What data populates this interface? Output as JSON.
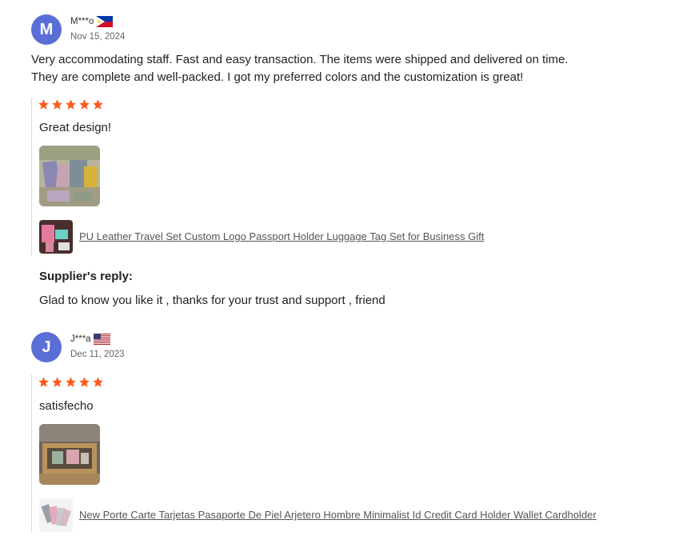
{
  "reviews": [
    {
      "avatar_letter": "M",
      "username": "M***o",
      "flag": "philippines-flag",
      "date": "Nov 15, 2024",
      "text_lines": [
        "Very accommodating staff. Fast and easy transaction. The items were shipped and delivered on time.",
        "They are complete and well-packed. I got my preferred colors and the customization is great!"
      ],
      "rating": 5,
      "comment": "Great design!",
      "product_link": "PU Leather Travel Set Custom Logo Passport Holder Luggage Tag Set for Business Gift",
      "reply": {
        "title": "Supplier's reply:",
        "text": "Glad to know you like it , thanks for your trust and support , friend"
      }
    },
    {
      "avatar_letter": "J",
      "username": "J***a",
      "flag": "usa-flag",
      "date": "Dec 11, 2023",
      "rating": 5,
      "comment": "satisfecho",
      "product_link": "New Porte Carte Tarjetas Pasaporte De Piel Arjetero Hombre Minimalist Id Credit Card Holder Wallet Cardholder"
    }
  ],
  "colors": {
    "avatar": "#5b6ed6",
    "star": "#ff5a1f",
    "divider": "#dcdcdc"
  }
}
